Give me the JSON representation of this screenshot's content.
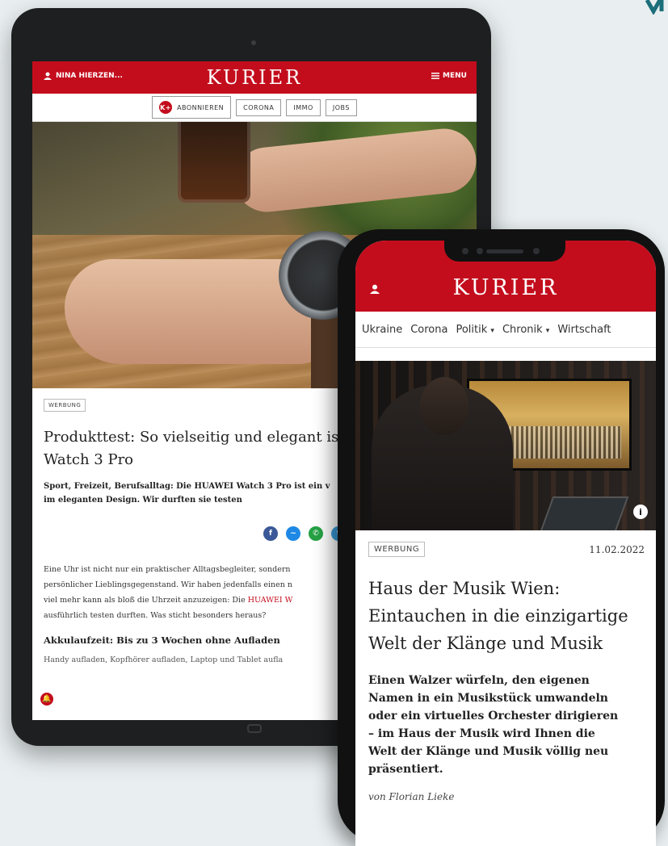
{
  "colors": {
    "brand_red": "#c30d1c",
    "background": "#e9eff1"
  },
  "tablet": {
    "header": {
      "user_name": "NINA HIERZEN...",
      "logo": "KURIER",
      "menu_label": "MENU"
    },
    "nav_pills": [
      {
        "label": "ABONNIEREN",
        "badge": "K+"
      },
      {
        "label": "CORONA"
      },
      {
        "label": "IMMO"
      },
      {
        "label": "JOBS"
      }
    ],
    "article": {
      "ad_label": "WERBUNG",
      "title_line1": "Produkttest: So vielseitig und elegant ist d",
      "title_line2": "Watch 3 Pro",
      "lead_line1": "Sport, Freizeit, Berufsalltag: Die HUAWEI Watch 3 Pro ist ein v",
      "lead_line2": "im eleganten Design. Wir durften sie testen",
      "share_icons": [
        "facebook-icon",
        "messenger-icon",
        "whatsapp-icon",
        "twitter-icon",
        "email-icon",
        "pocket-icon"
      ],
      "para_line1": "Eine Uhr ist nicht nur ein praktischer Alltagsbegleiter, sondern",
      "para_line2": "persönlicher Lieblingsgegenstand. Wir haben jedenfalls einen n",
      "para_line3_a": "viel mehr kann als bloß die Uhrzeit anzuzeigen: Die ",
      "para_line3_link": "HUAWEI W",
      "para_line4": "ausführlich testen durften. Was sticht besonders heraus?",
      "subheading": "Akkulaufzeit: Bis zu 3 Wochen ohne Aufladen",
      "cut_line": "Handy aufladen, Kopfhörer aufladen, Laptop und Tablet aufla"
    }
  },
  "phone": {
    "header": {
      "logo": "KURIER"
    },
    "nav": [
      "Ukraine",
      "Corona",
      "Politik",
      "Chronik",
      "Wirtschaft"
    ],
    "article": {
      "ad_label": "WERBUNG",
      "date": "11.02.2022",
      "title_line1": "Haus der Musik Wien:",
      "title_line2": "Eintauchen in die einzigartige",
      "title_line3": "Welt der Klänge und Musik",
      "lead_line1": "Einen Walzer würfeln, den eigenen",
      "lead_line2": "Namen in ein Musikstück umwandeln",
      "lead_line3": "oder ein virtuelles Orchester dirigieren",
      "lead_line4": "– im Haus der Musik wird Ihnen die",
      "lead_line5": "Welt der Klänge und Musik völlig neu",
      "lead_line6": "präsentiert.",
      "author": "von Florian Lieke"
    }
  }
}
